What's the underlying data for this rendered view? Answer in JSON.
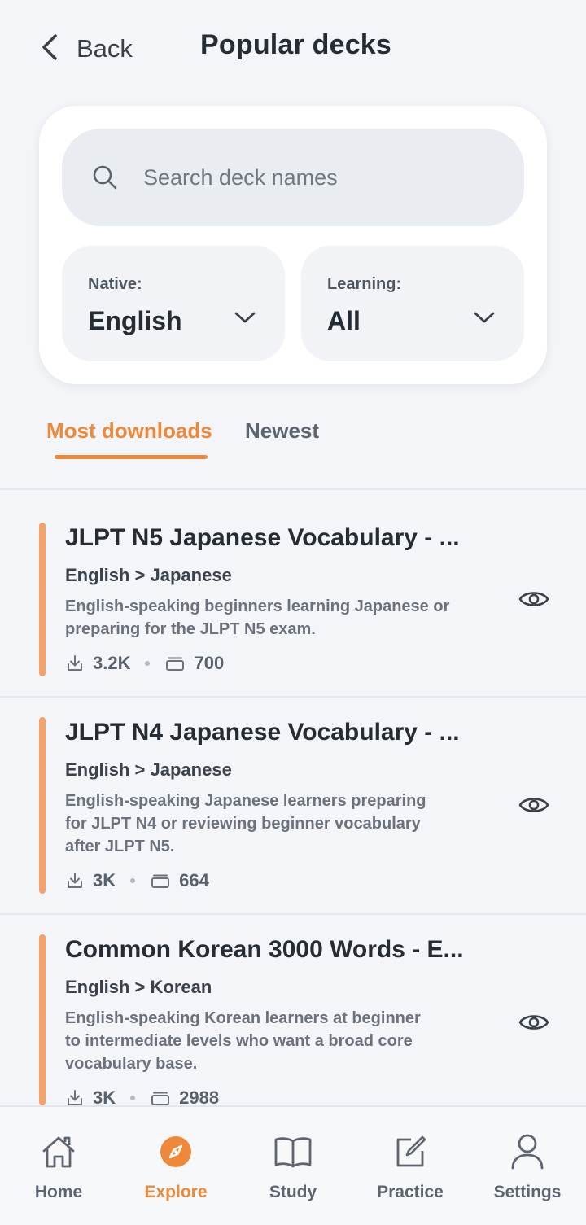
{
  "header": {
    "back_label": "Back",
    "title": "Popular decks"
  },
  "filters": {
    "search_placeholder": "Search deck names",
    "native": {
      "label": "Native:",
      "value": "English"
    },
    "learning": {
      "label": "Learning:",
      "value": "All"
    }
  },
  "tabs": [
    {
      "label": "Most downloads",
      "active": true
    },
    {
      "label": "Newest",
      "active": false
    }
  ],
  "decks": [
    {
      "title": "JLPT N5 Japanese Vocabulary - ...",
      "pair": "English > Japanese",
      "description": [
        "English-speaking beginners learning Japanese or",
        "preparing for the JLPT N5 exam."
      ],
      "downloads": "3.2K",
      "cards": "700"
    },
    {
      "title": "JLPT N4 Japanese Vocabulary - ...",
      "pair": "English > Japanese",
      "description": [
        "English-speaking Japanese learners preparing",
        "for JLPT N4 or reviewing beginner vocabulary",
        "after JLPT N5."
      ],
      "downloads": "3K",
      "cards": "664"
    },
    {
      "title": "Common Korean 3000 Words - E...",
      "pair": "English > Korean",
      "description": [
        "English-speaking Korean learners at beginner",
        "to intermediate levels who want a broad core",
        "vocabulary base."
      ],
      "downloads": "3K",
      "cards": "2988"
    }
  ],
  "nav": [
    {
      "label": "Home",
      "icon": "home-icon",
      "active": false
    },
    {
      "label": "Explore",
      "icon": "compass-icon",
      "active": true
    },
    {
      "label": "Study",
      "icon": "book-icon",
      "active": false
    },
    {
      "label": "Practice",
      "icon": "edit-icon",
      "active": false
    },
    {
      "label": "Settings",
      "icon": "user-icon",
      "active": false
    }
  ],
  "colors": {
    "accent": "#f0883a",
    "deck_bar": "#f3a26b",
    "background": "#f3f5f8",
    "text_primary": "#262c33",
    "text_secondary": "#6b727c"
  }
}
